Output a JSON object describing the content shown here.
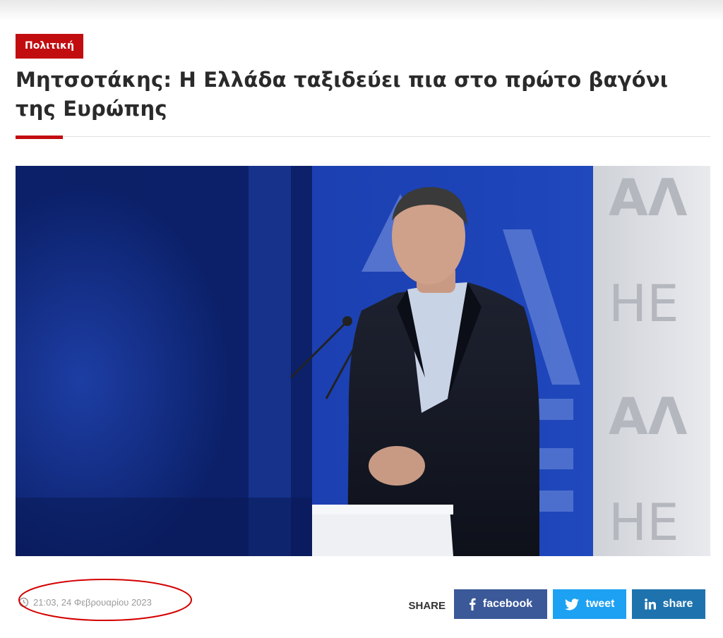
{
  "article": {
    "category": "Πολιτική",
    "title": "Μητσοτάκης: Η Ελλάδα ταξιδεύει πια στο πρώτο βαγόνι της Ευρώπης",
    "timestamp": "21:03, 24 Φεβρουαρίου 2023"
  },
  "share": {
    "label": "SHARE",
    "buttons": [
      {
        "label": "facebook",
        "icon": "facebook-icon",
        "color": "#3b5998"
      },
      {
        "label": "tweet",
        "icon": "twitter-icon",
        "color": "#1da1f2"
      },
      {
        "label": "share",
        "icon": "linkedin-icon",
        "color": "#1e73ae"
      }
    ]
  },
  "theme": {
    "accent": "#c20d10",
    "annotation_color": "#d40000"
  }
}
